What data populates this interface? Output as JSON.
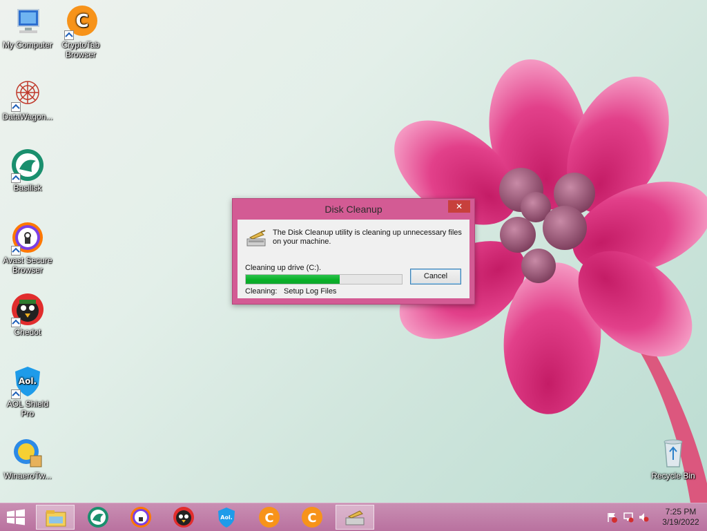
{
  "desktop": {
    "icons": [
      {
        "label": "My Computer"
      },
      {
        "label": "CryptoTab Browser"
      },
      {
        "label": "DataWagon..."
      },
      {
        "label": "Basilisk"
      },
      {
        "label": "Avast Secure Browser"
      },
      {
        "label": "Chedot"
      },
      {
        "label": "AOL Shield Pro"
      },
      {
        "label": "WinaeroTw..."
      },
      {
        "label": "Recycle Bin"
      }
    ]
  },
  "dialog": {
    "title": "Disk Cleanup",
    "close_label": "✕",
    "message": "The Disk Cleanup utility is cleaning up unnecessary files on your machine.",
    "drive_label": "Cleaning up drive  (C:).",
    "progress_percent": 60,
    "cleaning_label": "Cleaning:",
    "cleaning_item": "Setup Log Files",
    "cancel_label": "Cancel"
  },
  "taskbar": {
    "items": [
      {
        "name": "file-explorer"
      },
      {
        "name": "basilisk"
      },
      {
        "name": "avast-secure-browser"
      },
      {
        "name": "chedot"
      },
      {
        "name": "aol-shield-pro"
      },
      {
        "name": "cryptotab-browser-1"
      },
      {
        "name": "cryptotab-browser-2"
      },
      {
        "name": "disk-cleanup",
        "active": true
      }
    ],
    "clock": {
      "time": "7:25 PM",
      "date": "3/19/2022"
    }
  },
  "colors": {
    "window_frame": "#d35b94",
    "taskbar": "#c98fb3",
    "progress": "#06b025"
  }
}
